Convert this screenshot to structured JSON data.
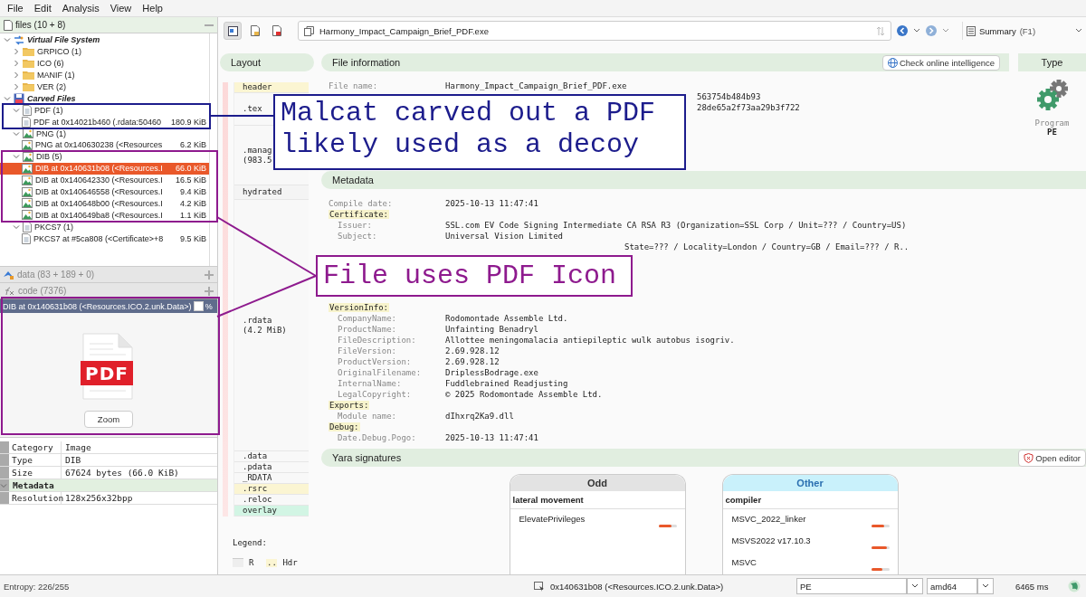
{
  "menu": [
    "File",
    "Edit",
    "Analysis",
    "View",
    "Help"
  ],
  "files_panel": {
    "title": "files (10 + 8)",
    "tree": [
      {
        "label": "Virtual File System",
        "kind": "system",
        "expanded": true,
        "selected": false,
        "children": [
          {
            "label": "GRPICO (1)",
            "kind": "folder",
            "expanded": false,
            "selected": false
          },
          {
            "label": "ICO (6)",
            "kind": "folder",
            "expanded": false,
            "selected": false
          },
          {
            "label": "MANIF (1)",
            "kind": "folder",
            "expanded": false,
            "selected": false
          },
          {
            "label": "VER (2)",
            "kind": "folder",
            "expanded": false,
            "selected": false
          }
        ]
      },
      {
        "label": "Carved Files",
        "kind": "disk",
        "expanded": true,
        "selected": false,
        "children": [
          {
            "label": "PDF (1)",
            "kind": "document",
            "expanded": true,
            "selected": false,
            "children": [
              {
                "label": "PDF at 0x14021b460 (.rdata:50460",
                "size": "180.9 KiB",
                "kind": "document",
                "selected": false
              }
            ]
          },
          {
            "label": "PNG (1)",
            "kind": "image",
            "expanded": true,
            "selected": false,
            "children": [
              {
                "label": "PNG at 0x140630238 (<Resources",
                "size": "6.2 KiB",
                "kind": "image",
                "selected": false
              }
            ]
          },
          {
            "label": "DIB (5)",
            "kind": "image",
            "expanded": true,
            "selected": false,
            "children": [
              {
                "label": "DIB at 0x140631b08 (<Resources.I",
                "size": "66.0 KiB",
                "kind": "image",
                "selected": true
              },
              {
                "label": "DIB at 0x140642330 (<Resources.I",
                "size": "16.5 KiB",
                "kind": "image",
                "selected": false
              },
              {
                "label": "DIB at 0x140646558 (<Resources.I",
                "size": "9.4 KiB",
                "kind": "image",
                "selected": false
              },
              {
                "label": "DIB at 0x140648b00 (<Resources.I",
                "size": "4.2 KiB",
                "kind": "image",
                "selected": false
              },
              {
                "label": "DIB at 0x140649ba8 (<Resources.I",
                "size": "1.1 KiB",
                "kind": "image",
                "selected": false
              }
            ]
          },
          {
            "label": "PKCS7 (1)",
            "kind": "document",
            "expanded": true,
            "selected": false,
            "children": [
              {
                "label": "PKCS7 at #5ca808 (<Certificate>+8",
                "size": "9.5 KiB",
                "kind": "document",
                "selected": false
              }
            ]
          }
        ]
      }
    ],
    "panels": [
      {
        "kind": "data",
        "title": "data (83 + 189 + 0)"
      },
      {
        "kind": "code",
        "title": "code (7376)"
      }
    ]
  },
  "preview": {
    "title": "DIB at 0x140631b08 (<Resources.ICO.2.unk.Data>)",
    "checked": false,
    "suffix": "%",
    "badge": "PDF",
    "button": "Zoom"
  },
  "properties": [
    {
      "kind": "field",
      "key": "Category",
      "value": "Image"
    },
    {
      "kind": "field",
      "key": "Type",
      "value": "DIB"
    },
    {
      "kind": "field",
      "key": "Size",
      "value": "67624 bytes (66.0 KiB)"
    },
    {
      "kind": "section",
      "key": "Metadata",
      "expanded": true
    },
    {
      "kind": "field",
      "key": "Resolution",
      "value": "128x256x32bpp"
    }
  ],
  "toolbar": {
    "path": "Harmony_Impact_Campaign_Brief_PDF.exe",
    "view": "Summary",
    "shortcut": "(F1)"
  },
  "layout": {
    "title": "Layout",
    "sections": [
      {
        "label": "header",
        "color": "#fbf5d2"
      },
      {
        "label": ".tex",
        "color": "#f8f8f8"
      },
      {
        "label": ".manag",
        "sub": "(983.5",
        "color": "#f8f8f8"
      },
      {
        "label": "hydrated",
        "color": "#f4f4f4"
      },
      {
        "label": ".rdata",
        "sub": "(4.2 MiB)",
        "color": "#f8f8f8"
      },
      {
        "label": ".data",
        "color": "#f8f8f8"
      },
      {
        "label": ".pdata",
        "color": "#f8f8f8"
      },
      {
        "label": "_RDATA",
        "color": "#f8f8f8"
      },
      {
        "label": ".rsrc",
        "color": "#fbf5d2"
      },
      {
        "label": ".reloc",
        "color": "#f8f8f8"
      },
      {
        "label": "overlay",
        "color": "#d2f5e4"
      }
    ],
    "legend_title": "Legend:",
    "legend": [
      {
        "label": "R"
      },
      {
        "mark": "..",
        "label": "Hdr"
      }
    ]
  },
  "file_info": {
    "title": "File information",
    "button": "Check online intelligence",
    "rows": [
      {
        "kind": "field",
        "label": "File name:",
        "value": "Harmony_Impact_Campaign_Brief_PDF.exe"
      },
      {
        "kind": "partial",
        "value": "563754b484b93"
      },
      {
        "kind": "partial",
        "value": "28de65a2f73aa29b3f722"
      }
    ]
  },
  "type_panel": {
    "title": "Type",
    "category": "Program",
    "format": "PE"
  },
  "metadata": {
    "title": "Metadata",
    "rows": [
      {
        "kind": "field",
        "label": "Compile date:",
        "value": "2025-10-13 11:47:41"
      },
      {
        "kind": "heading",
        "label": "Certificate:"
      },
      {
        "kind": "subfield",
        "label": "Issuer:",
        "value": "SSL.com EV Code Signing Intermediate CA RSA R3 (Organization=SSL Corp / Unit=??? / Country=US)"
      },
      {
        "kind": "subfield",
        "label": "Subject:",
        "value": "Universal Vision Limited"
      },
      {
        "kind": "partial",
        "value": "State=??? / Locality=London / Country=GB / Email=??? / R.."
      },
      {
        "kind": "heading",
        "label": "VersionInfo:"
      },
      {
        "kind": "subfield",
        "label": "CompanyName:",
        "value": "Rodomontade Assemble Ltd."
      },
      {
        "kind": "subfield",
        "label": "ProductName:",
        "value": "Unfainting Benadryl"
      },
      {
        "kind": "subfield",
        "label": "FileDescription:",
        "value": "Allottee meningomalacia antiepileptic wulk autobus isogriv."
      },
      {
        "kind": "subfield",
        "label": "FileVersion:",
        "value": "2.69.928.12"
      },
      {
        "kind": "subfield",
        "label": "ProductVersion:",
        "value": "2.69.928.12"
      },
      {
        "kind": "subfield",
        "label": "OriginalFilename:",
        "value": "DriplessBodrage.exe"
      },
      {
        "kind": "subfield",
        "label": "InternalName:",
        "value": "Fuddlebrained Readjusting"
      },
      {
        "kind": "subfield",
        "label": "LegalCopyright:",
        "value": "© 2025 Rodomontade Assemble Ltd."
      },
      {
        "kind": "heading",
        "label": "Exports:"
      },
      {
        "kind": "subfield",
        "label": "Module name:",
        "value": "dIhxrq2Ka9.dll"
      },
      {
        "kind": "heading",
        "label": "Debug:"
      },
      {
        "kind": "subfield",
        "label": "Date.Debug.Pogo:",
        "value": "2025-10-13 11:47:41"
      }
    ]
  },
  "yara": {
    "title": "Yara signatures",
    "button": "Open editor",
    "groups": [
      {
        "title": "Odd",
        "color": "#e3e3e3",
        "category": "lateral movement",
        "rules": [
          {
            "name": "ElevatePrivileges",
            "level": 0.7
          }
        ]
      },
      {
        "title": "Other",
        "color": "#c9f1fb",
        "category": "compiler",
        "rules": [
          {
            "name": "MSVC_2022_linker",
            "level": 0.7
          },
          {
            "name": "MSVS2022 v17.10.3",
            "level": 0.85
          },
          {
            "name": "MSVC",
            "level": 0.6
          }
        ]
      }
    ]
  },
  "status_bar": {
    "entropy": "Entropy: 226/255",
    "address": "0x140631b08 (<Resources.ICO.2.unk.Data>)",
    "format": "PE",
    "arch": "amd64",
    "time": "6465 ms"
  },
  "annotations": [
    {
      "text": "Malcat carved out a PDF likely used as a decoy",
      "color": "#1c1c8c"
    },
    {
      "text": "File uses PDF Icon",
      "color": "#8e1a8e"
    }
  ]
}
